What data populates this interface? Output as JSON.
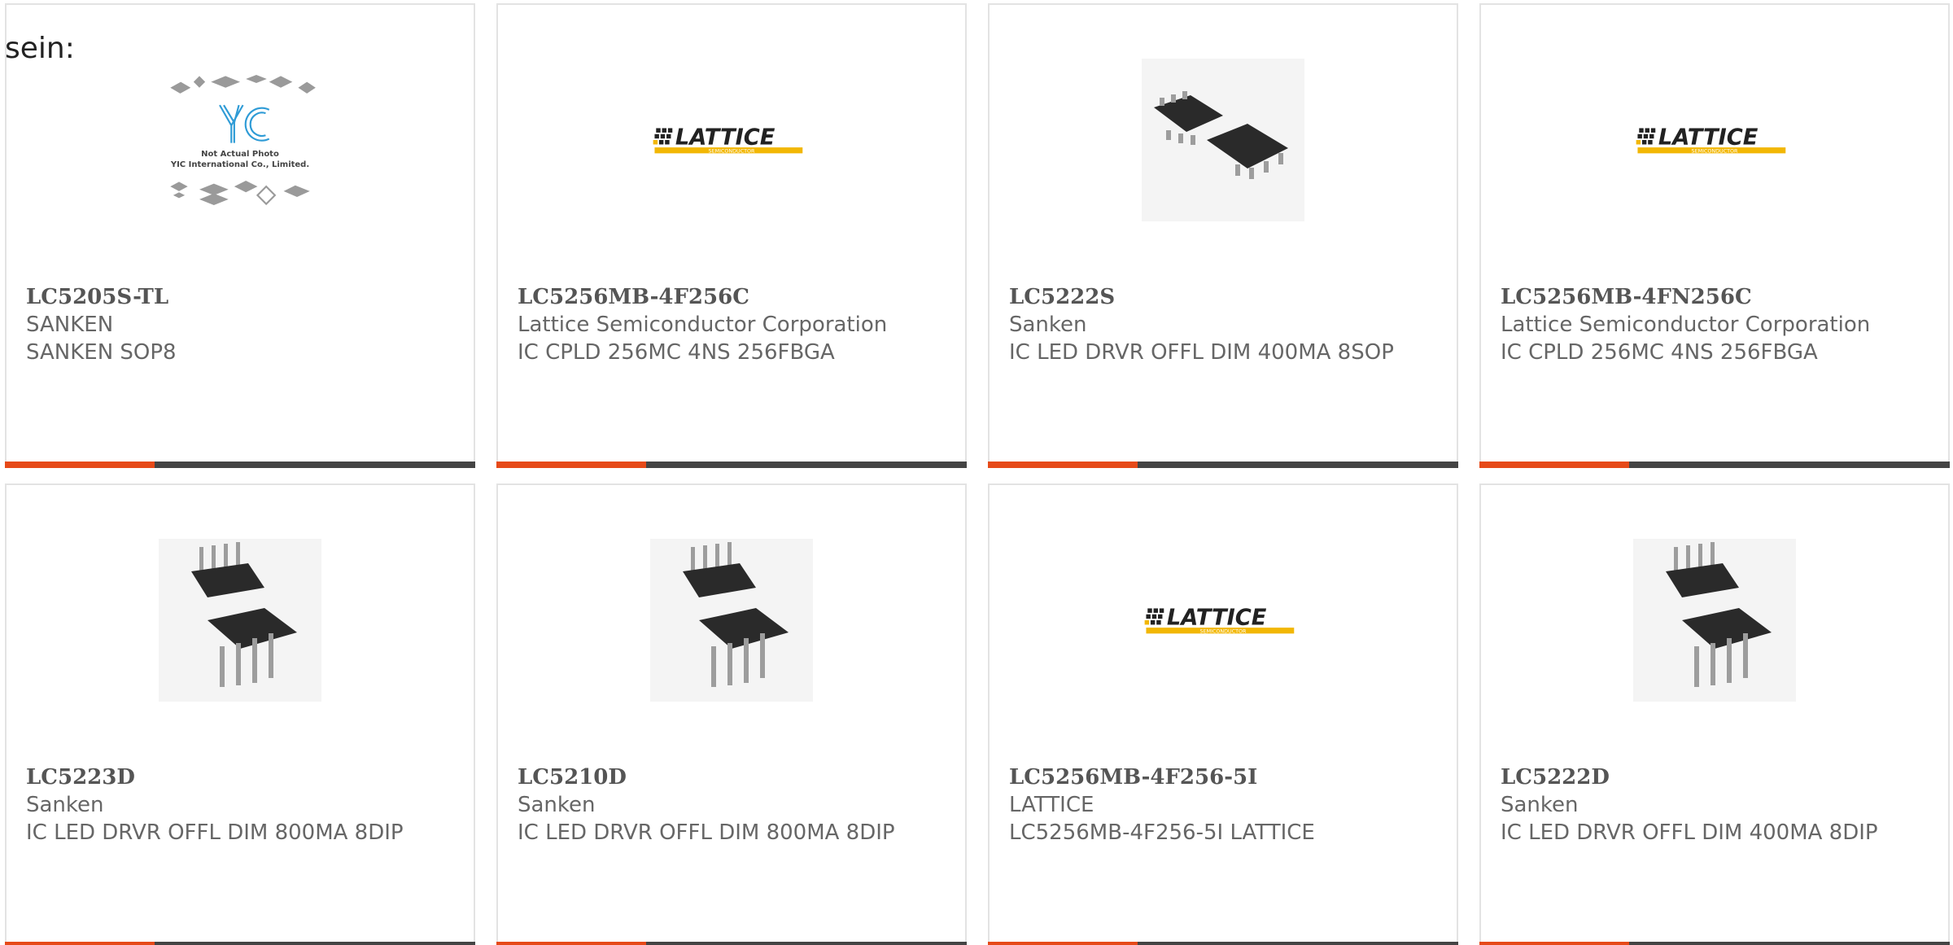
{
  "intro": {
    "text": "sein:"
  },
  "products": [
    {
      "part": "LC5205S-TL",
      "manufacturer": "SANKEN",
      "description": "SANKEN SOP8",
      "image": "yic-placeholder",
      "image_caption_1": "Not Actual Photo",
      "image_caption_2": "YIC International Co., Limited."
    },
    {
      "part": "LC5256MB-4F256C",
      "manufacturer": "Lattice Semiconductor Corporation",
      "description": "IC CPLD 256MC 4NS 256FBGA",
      "image": "lattice-logo",
      "logo_text": "LATTICE",
      "logo_subtext": "SEMICONDUCTOR"
    },
    {
      "part": "LC5222S",
      "manufacturer": "Sanken",
      "description": "IC LED DRVR OFFL DIM 400MA 8SOP",
      "image": "soic8-package"
    },
    {
      "part": "LC5256MB-4FN256C",
      "manufacturer": "Lattice Semiconductor Corporation",
      "description": "IC CPLD 256MC 4NS 256FBGA",
      "image": "lattice-logo",
      "logo_text": "LATTICE",
      "logo_subtext": "SEMICONDUCTOR"
    },
    {
      "part": "LC5223D",
      "manufacturer": "Sanken",
      "description": "IC LED DRVR OFFL DIM 800MA 8DIP",
      "image": "dip8-package"
    },
    {
      "part": "LC5210D",
      "manufacturer": "Sanken",
      "description": "IC LED DRVR OFFL DIM 800MA 8DIP",
      "image": "dip8-package"
    },
    {
      "part": "LC5256MB-4F256-5I",
      "manufacturer": "LATTICE",
      "description": "LC5256MB-4F256-5I LATTICE",
      "image": "lattice-logo",
      "logo_text": "LATTICE",
      "logo_subtext": "SEMICONDUCTOR"
    },
    {
      "part": "LC5222D",
      "manufacturer": "Sanken",
      "description": "IC LED DRVR OFFL DIM 400MA 8DIP",
      "image": "dip8-package"
    }
  ],
  "colors": {
    "accent": "#e64a19",
    "bar": "#444444",
    "border": "#e3e3e3",
    "logo_gold": "#f2b705"
  }
}
